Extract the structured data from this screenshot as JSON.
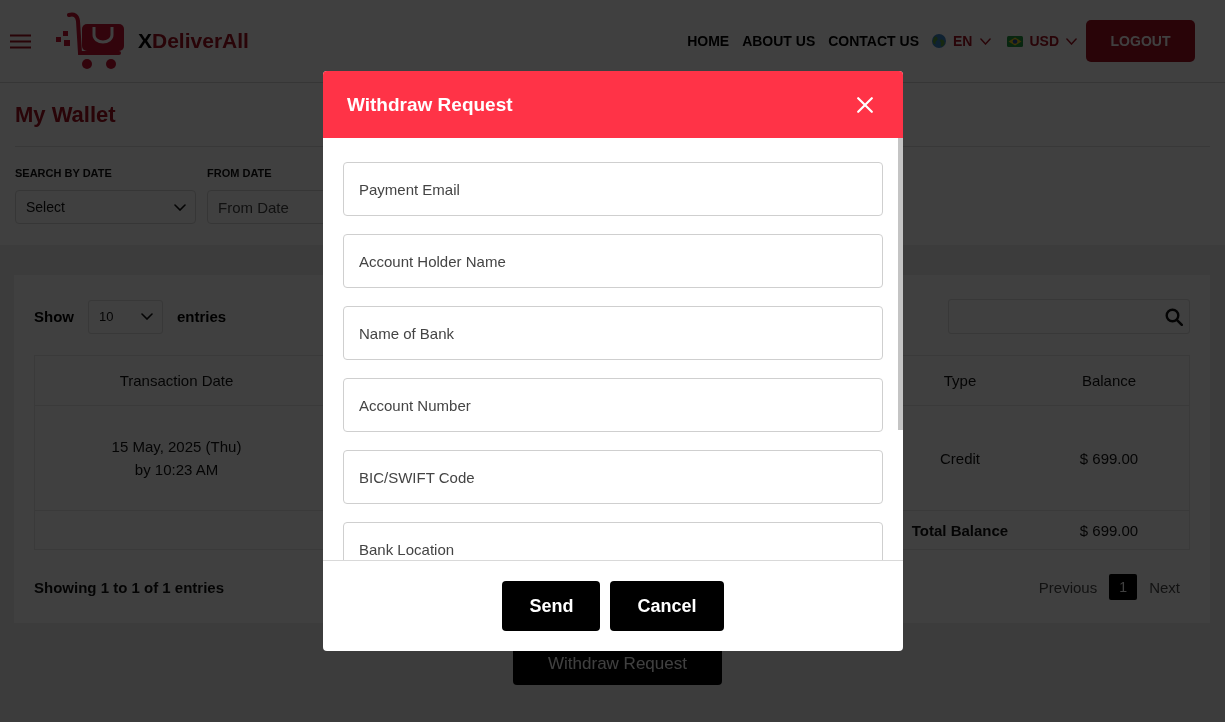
{
  "header": {
    "brand": {
      "mark": "X",
      "name": "DeliverAll"
    },
    "nav": [
      "HOME",
      "ABOUT US",
      "CONTACT US"
    ],
    "language": {
      "label": "EN"
    },
    "currency": {
      "label": "USD"
    },
    "logout": "LOGOUT"
  },
  "wallet": {
    "title": "My Wallet",
    "filters": [
      {
        "kind": "select",
        "label": "SEARCH BY DATE",
        "value": "Select"
      },
      {
        "kind": "date",
        "label": "FROM DATE",
        "placeholder": "From Date"
      }
    ]
  },
  "transactions": {
    "length_menu": {
      "prefix": "Show",
      "value": "10",
      "suffix": "entries"
    },
    "columns": [
      "Transaction Date",
      "Type",
      "Balance"
    ],
    "rows": [
      {
        "transaction_date": [
          "15 May, 2025 (Thu)",
          "by 10:23 AM"
        ],
        "type": "Credit",
        "balance": "$ 699.00"
      }
    ],
    "total": {
      "label": "Total Balance",
      "value": "$ 699.00"
    },
    "info": "Showing 1 to 1 of 1 entries",
    "pagination": {
      "previous": {
        "label": "Previous",
        "disabled": true
      },
      "pages": [
        {
          "label": "1",
          "selected": true
        }
      ],
      "next": {
        "label": "Next",
        "disabled": true
      }
    }
  },
  "withdraw_button": "Withdraw Request",
  "modal": {
    "title": "Withdraw Request",
    "fields": [
      {
        "placeholder": "Payment Email"
      },
      {
        "placeholder": "Account Holder Name"
      },
      {
        "placeholder": "Name of Bank"
      },
      {
        "placeholder": "Account Number"
      },
      {
        "placeholder": "BIC/SWIFT Code"
      },
      {
        "placeholder": "Bank Location"
      }
    ],
    "buttons": [
      "Send",
      "Cancel"
    ]
  }
}
